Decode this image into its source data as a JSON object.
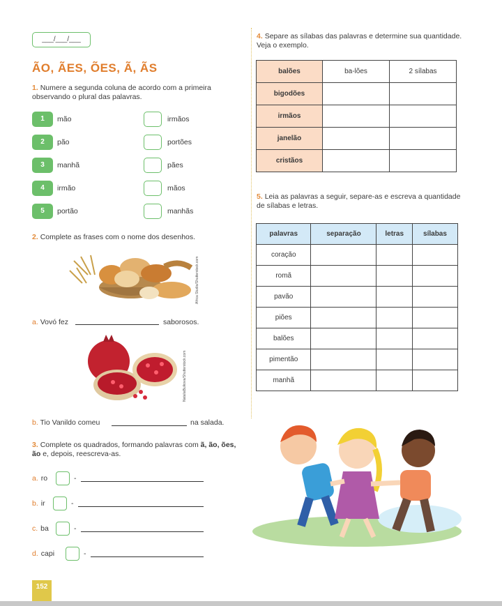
{
  "header": {
    "date_box": "___/___/___"
  },
  "title": "ÃO, ÃES, ÕES, Ã, ÃS",
  "q1": {
    "number": "1.",
    "instruction": "Numere a segunda coluna de acordo com a primeira observando o plural das palavras.",
    "left": [
      {
        "n": "1",
        "word": "mão"
      },
      {
        "n": "2",
        "word": "pão"
      },
      {
        "n": "3",
        "word": "manhã"
      },
      {
        "n": "4",
        "word": "irmão"
      },
      {
        "n": "5",
        "word": "portão"
      }
    ],
    "right": [
      "irmãos",
      "portões",
      "pães",
      "mãos",
      "manhãs"
    ]
  },
  "q2": {
    "number": "2.",
    "instruction": "Complete as frases com o nome dos desenhos.",
    "credit_a": "Africa Studio/Shutterstock.com",
    "credit_b": "NataliaBulkova/Shutterstock.com",
    "a_prefix": "a.",
    "a_text1": "Vovó fez",
    "a_text2": "saborosos.",
    "b_prefix": "b.",
    "b_text1": "Tio Vanildo comeu",
    "b_text2": "na salada."
  },
  "q3": {
    "number": "3.",
    "instruction_1": "Complete os quadrados, formando palavras com",
    "bold_1": "ã,",
    "bold_2": "ão, ões, ão",
    "instruction_2": "e, depois, reescreva-as.",
    "items": [
      {
        "letter": "a.",
        "stem": "ro"
      },
      {
        "letter": "b.",
        "stem": "ir"
      },
      {
        "letter": "c.",
        "stem": "ba"
      },
      {
        "letter": "d.",
        "stem": "capi"
      }
    ],
    "dash": "-"
  },
  "q4": {
    "number": "4.",
    "instruction": "Separe as sílabas das palavras e determine sua quantidade. Veja o exemplo.",
    "rows": [
      {
        "word": "balões",
        "sep": "ba-lões",
        "count": "2 sílabas"
      },
      {
        "word": "bigodões",
        "sep": "",
        "count": ""
      },
      {
        "word": "irmãos",
        "sep": "",
        "count": ""
      },
      {
        "word": "janelão",
        "sep": "",
        "count": ""
      },
      {
        "word": "cristãos",
        "sep": "",
        "count": ""
      }
    ]
  },
  "q5": {
    "number": "5.",
    "instruction": "Leia as palavras a seguir, separe-as e escreva a quantidade de sílabas e letras.",
    "headers": [
      "palavras",
      "separação",
      "letras",
      "sílabas"
    ],
    "words": [
      "coração",
      "romã",
      "pavão",
      "piões",
      "balões",
      "pimentão",
      "manhã"
    ]
  },
  "page_number": "152",
  "colors": {
    "accent_orange": "#e07d2c",
    "accent_green": "#6cbf6a",
    "table4_header": "#fbdcc6",
    "table5_header": "#d3e9f7"
  }
}
